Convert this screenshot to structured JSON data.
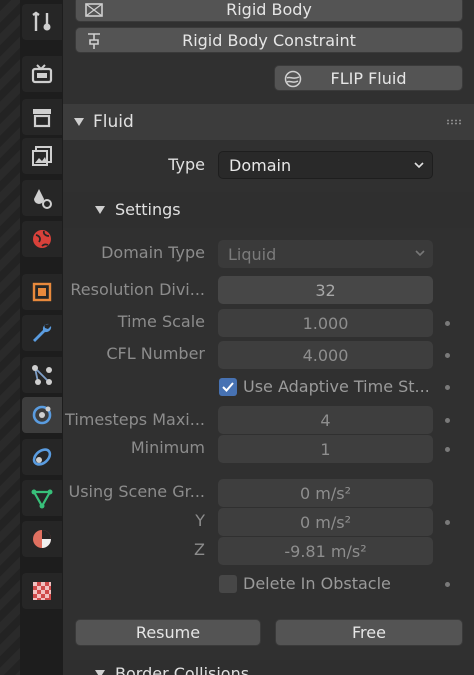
{
  "top_buttons": {
    "rigid_body": "Rigid Body",
    "rigid_body_constraint": "Rigid Body Constraint",
    "flip_fluid": "FLIP Fluid"
  },
  "fluid_panel": {
    "title": "Fluid",
    "type_label": "Type",
    "type_value": "Domain"
  },
  "settings": {
    "title": "Settings",
    "domain_type_label": "Domain Type",
    "domain_type_value": "Liquid",
    "resolution_label": "Resolution Divi...",
    "resolution_value": "32",
    "time_scale_label": "Time Scale",
    "time_scale_value": "1.000",
    "cfl_label": "CFL Number",
    "cfl_value": "4.000",
    "adaptive_label": "Use Adaptive Time St...",
    "adaptive_checked": true,
    "timesteps_max_label": "Timesteps Maxi...",
    "timesteps_max_value": "4",
    "minimum_label": "Minimum",
    "minimum_value": "1",
    "gravity_label": "Using Scene Gr...",
    "gravity_x": "0 m/s²",
    "y_label": "Y",
    "gravity_y": "0 m/s²",
    "z_label": "Z",
    "gravity_z": "-9.81 m/s²",
    "delete_obstacle_label": "Delete In Obstacle",
    "delete_obstacle_checked": false,
    "resume_label": "Resume",
    "free_label": "Free"
  },
  "next_section": {
    "title": "Border Collisions"
  },
  "colors": {
    "accent": "#4772b3",
    "panel_bg": "#303030",
    "field_bg": "#545454"
  },
  "tabs": [
    "tool-icon",
    "render-icon",
    "output-icon",
    "view-layer-icon",
    "scene-icon",
    "world-icon",
    "object-icon",
    "modifier-icon",
    "particles-icon",
    "physics-icon",
    "constraints-icon",
    "data-icon",
    "material-icon",
    "texture-icon"
  ]
}
